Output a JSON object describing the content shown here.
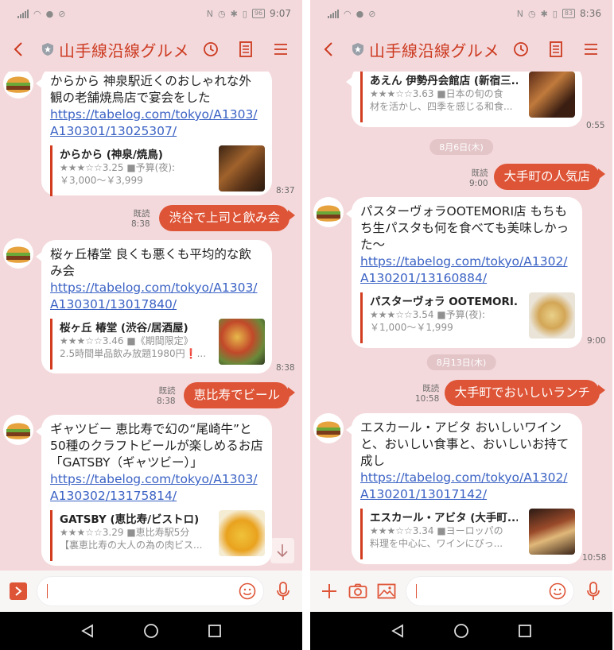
{
  "colors": {
    "accent": "#de5436",
    "chat_bg": "#f4d9dc",
    "link": "#3b62c4",
    "header_title": "#cc3a20"
  },
  "icons": {
    "back": "chevron-left-icon",
    "shield": "shield-icon",
    "clock": "clock-icon",
    "notes": "notes-icon",
    "menu": "menu-icon",
    "scroll": "arrow-down-icon",
    "plus": "plus-icon",
    "camera": "camera-icon",
    "image": "image-icon",
    "emoji": "emoji-icon",
    "mic": "mic-icon"
  },
  "screens": [
    {
      "status": {
        "battery": "96",
        "time": "9:07"
      },
      "header": {
        "title": "山手線沿線グルメ"
      },
      "messages": [
        {
          "text": "からから 神泉駅近くのおしゃれな外観の老舗焼鳥店で宴会をした",
          "link": "https://tabelog.com/tokyo/A1303/A130301/13025307/",
          "card": {
            "title": "からから (神泉/焼鳥)",
            "line1": "★★★☆☆3.25 ■予算(夜):",
            "line2": "￥3,000～￥3,999"
          },
          "time": "8:37"
        },
        {
          "read": "既読",
          "read_time": "8:38",
          "text": "渋谷で上司と飲み会"
        },
        {
          "text": "桜ヶ丘椿堂 良くも悪くも平均的な飲み会",
          "link": "https://tabelog.com/tokyo/A1303/A130301/13017840/",
          "card": {
            "title": "桜ヶ丘 椿堂 (渋谷/居酒屋)",
            "line1": "★★★☆☆3.46 ■《期間限定》",
            "line2": "2.5時間単品飲み放題1980円❗..."
          },
          "time": "8:38"
        },
        {
          "read": "既読",
          "read_time": "8:38",
          "text": "恵比寿でビール"
        },
        {
          "text": "ギャツビー 恵比寿で幻の“尾崎牛”と50種のクラフトビールが楽しめるお店「GATSBY（ギャツビー）」",
          "link": "https://tabelog.com/tokyo/A1303/A130302/13175814/",
          "card": {
            "title": "GATSBY (恵比寿/ビストロ)",
            "line1": "★★★☆☆3.29 ■恵比寿駅5分",
            "line2": "【裏恵比寿の大人の為の肉ビス..."
          }
        }
      ],
      "input": {
        "placeholder": ""
      }
    },
    {
      "status": {
        "battery": "83",
        "time": "8:36"
      },
      "header": {
        "title": "山手線沿線グルメ"
      },
      "messages": [
        {
          "card": {
            "title": "あえん 伊勢丹会館店 (新宿三...",
            "line1": "★★★☆☆3.63 ■日本の旬の食",
            "line2": "材を活かし、四季を感じる和食..."
          },
          "time": "0:55"
        },
        {
          "date": "8月6日(木)"
        },
        {
          "read": "既読",
          "read_time": "9:00",
          "text": "大手町の人気店"
        },
        {
          "text": "パスターヴォラOOTEMORI店 もちもち生パスタも何を食べても美味しかった〜",
          "link": "https://tabelog.com/tokyo/A1302/A130201/13160884/",
          "card": {
            "title": "パスターヴォラ OOTEMORI...",
            "line1": "★★★☆☆3.54 ■予算(夜):",
            "line2": "￥1,000～￥1,999"
          },
          "time": "9:00"
        },
        {
          "date": "8月13日(木)"
        },
        {
          "read": "既読",
          "read_time": "10:58",
          "text": "大手町でおいしいランチ"
        },
        {
          "text": "エスカール・アビタ おいしいワインと、おいしい食事と、おいしいお持て成し",
          "link": "https://tabelog.com/tokyo/A1302/A130201/13017142/",
          "card": {
            "title": "エスカール・アビタ (大手町...",
            "line1": "★★★☆☆3.34 ■ヨーロッパの",
            "line2": "料理を中心に、ワインにぴっ..."
          },
          "time": "10:58"
        }
      ],
      "input": {
        "placeholder": ""
      }
    }
  ]
}
